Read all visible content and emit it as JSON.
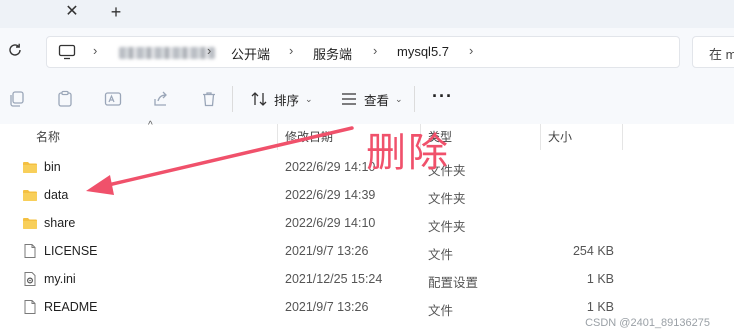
{
  "tabbar": {
    "close_glyph": "✕",
    "add_glyph": "+"
  },
  "address": {
    "separator": "›",
    "crumbs": [
      "公开端",
      "服务端",
      "mysql5.7"
    ],
    "search_placeholder": "在 m"
  },
  "toolbar": {
    "sort_label": "排序",
    "view_label": "查看",
    "more_label": "···",
    "chevron": "⌄"
  },
  "columns": {
    "name": "名称",
    "date": "修改日期",
    "type": "类型",
    "size": "大小",
    "sort_caret": "^"
  },
  "files": [
    {
      "name": "bin",
      "date": "2022/6/29 14:10",
      "type": "文件夹",
      "size": "",
      "icon": "folder-icon"
    },
    {
      "name": "data",
      "date": "2022/6/29 14:39",
      "type": "文件夹",
      "size": "",
      "icon": "folder-icon"
    },
    {
      "name": "share",
      "date": "2022/6/29 14:10",
      "type": "文件夹",
      "size": "",
      "icon": "folder-icon"
    },
    {
      "name": "LICENSE",
      "date": "2021/9/7 13:26",
      "type": "文件",
      "size": "254 KB",
      "icon": "file-icon"
    },
    {
      "name": "my.ini",
      "date": "2021/12/25 15:24",
      "type": "配置设置",
      "size": "1 KB",
      "icon": "settings-file-icon"
    },
    {
      "name": "README",
      "date": "2021/9/7 13:26",
      "type": "文件",
      "size": "1 KB",
      "icon": "file-icon"
    }
  ],
  "annotation": {
    "text": "删除",
    "color": "#f0516b"
  },
  "watermark": "CSDN @2401_89136275",
  "colors": {
    "folder": "#f4c042",
    "accent": "#f0516b"
  }
}
